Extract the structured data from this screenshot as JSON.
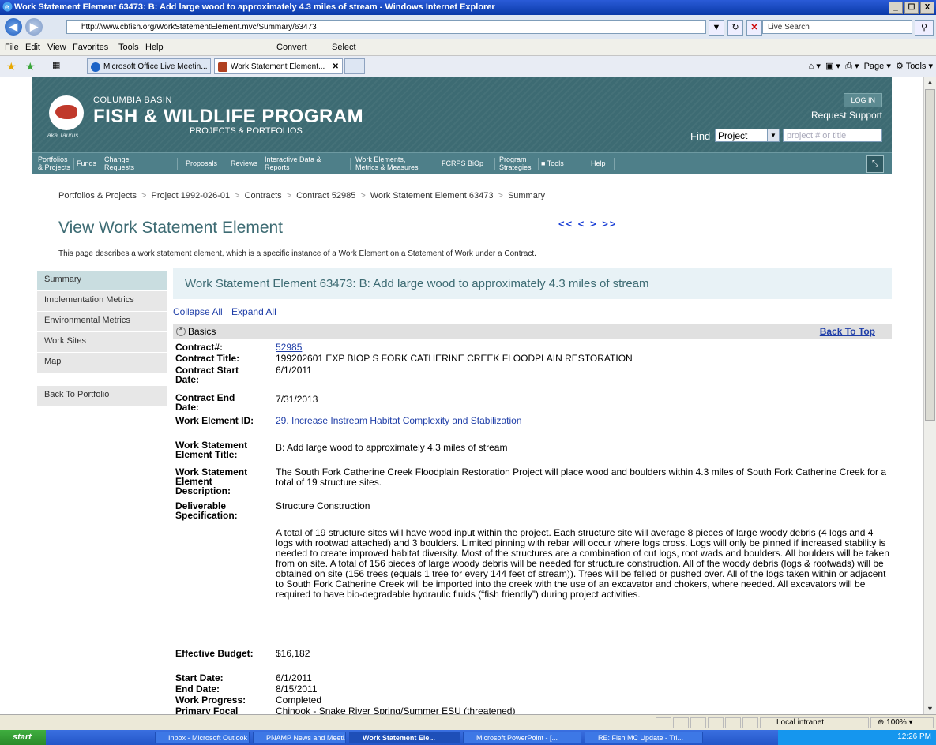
{
  "window": {
    "title": "Work Statement Element 63473: B: Add large wood to approximately 4.3 miles of stream - Windows Internet Explorer",
    "buttons": [
      "_",
      "☐",
      "X"
    ]
  },
  "address": {
    "url": "http://www.cbfish.org/WorkStatementElement.mvc/Summary/63473",
    "search_placeholder": "Live Search"
  },
  "menu": [
    "File",
    "Edit",
    "View",
    "Favorites",
    "Tools",
    "Help"
  ],
  "toolbar": {
    "convert": "Convert",
    "select": "Select"
  },
  "tabs": [
    {
      "label": "Microsoft Office Live Meetin..."
    },
    {
      "label": "Work Statement Element..."
    }
  ],
  "commandbar": {
    "page": "Page",
    "tools": "Tools"
  },
  "site": {
    "org_line1": "COLUMBIA BASIN",
    "org_line2": "FISH & WILDLIFE PROGRAM",
    "org_line3": "PROJECTS & PORTFOLIOS",
    "aka": "aka Taurus",
    "login": "LOG IN",
    "request_support": "Request Support",
    "find_label": "Find",
    "find_select": "Project",
    "find_placeholder": "project # or title"
  },
  "nav": [
    "Portfolios & Projects",
    "Funds",
    "Change Requests",
    "Proposals",
    "Reviews",
    "Interactive Data & Reports",
    "Work Elements, Metrics & Measures",
    "FCRPS BiOp",
    "Program Strategies",
    "Tools",
    "Help"
  ],
  "breadcrumb": [
    "Portfolios & Projects",
    "Project 1992-026-01",
    "Contracts",
    "Contract 52985",
    "Work Statement Element 63473",
    "Summary"
  ],
  "page": {
    "title": "View Work Statement Element",
    "pager": "<<  <  >  >>",
    "description": "This page describes a work statement element, which is a specific instance of a Work Element on a Statement of Work under a Contract."
  },
  "left_nav": [
    "Summary",
    "Implementation Metrics",
    "Environmental Metrics",
    "Work Sites",
    "Map"
  ],
  "back_to_portfolio": "Back To Portfolio",
  "wse_header": "Work Statement Element 63473: B: Add large wood to approximately 4.3 miles of stream",
  "collapse_all": "Collapse All",
  "expand_all": "Expand All",
  "section": {
    "label": "Basics",
    "back_to_top": "Back To Top"
  },
  "fields": [
    {
      "label": "Contract#:",
      "value": "52985",
      "link": true
    },
    {
      "label": "Contract Title:",
      "value": "199202601 EXP BIOP S FORK CATHERINE CREEK FLOODPLAIN RESTORATION"
    },
    {
      "label": "Contract Start Date:",
      "value": "6/1/2011"
    },
    {
      "label": "Contract End Date:",
      "value": "7/31/2013"
    },
    {
      "label": "Work Element ID:",
      "value": "29. Increase Instream Habitat Complexity and Stabilization",
      "link": true
    },
    {
      "label": "Work Statement Element Title:",
      "value": "B: Add large wood to approximately 4.3 miles of stream"
    },
    {
      "label": "Work Statement Element Description:",
      "value": "The South Fork Catherine Creek Floodplain Restoration Project will place wood and boulders within 4.3 miles of South Fork Catherine Creek for a total of 19 structure sites."
    },
    {
      "label": "Deliverable Specification:",
      "value": "Structure Construction"
    },
    {
      "label": "",
      "value": "A total of 19 structure sites will have wood input within the project. Each structure site will average 8 pieces of large woody debris (4 logs and 4 logs with rootwad attached) and 3 boulders. Limited pinning with rebar will occur where logs cross. Logs will only be pinned if increased stability is needed to create improved habitat diversity. Most of the structures are a combination of cut logs, root wads and boulders. All boulders will be taken from on site. A total of 156 pieces of large woody debris will be needed for structure construction. All of the woody debris (logs & rootwads) will be obtained on site (156 trees (equals 1 tree for every 144 feet of stream)). Trees will be felled or pushed over. All of the logs taken within or adjacent to South Fork Catherine Creek will be imported into the creek with the use of an excavator and chokers, where needed. All excavators will be required to have bio-degradable hydraulic fluids (“fish friendly”) during project activities."
    },
    {
      "label": "Effective Budget:",
      "value": "$16,182"
    },
    {
      "label": "Start Date:",
      "value": "6/1/2011"
    },
    {
      "label": "End Date:",
      "value": "8/15/2011"
    },
    {
      "label": "Work Progress:",
      "value": "Completed"
    },
    {
      "label": "Primary Focal Species:",
      "value": "Chinook - Snake River Spring/Summer ESU (threatened)"
    }
  ],
  "status": {
    "zone": "Local intranet",
    "zoom": "100%"
  },
  "taskbar": {
    "start": "start",
    "items": [
      "Inbox - Microsoft Outlook",
      "PNAMP News and Meeti...",
      "Work Statement Ele...",
      "Microsoft PowerPoint - [...",
      "RE: Fish MC Update - Tri..."
    ],
    "clock": "12:26 PM"
  }
}
